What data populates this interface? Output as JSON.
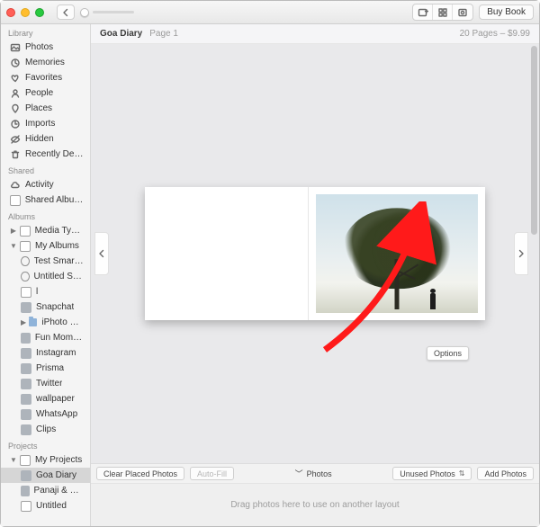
{
  "toolbar": {
    "buy_label": "Buy Book"
  },
  "sidebar": {
    "sections": {
      "library": "Library",
      "shared": "Shared",
      "albums": "Albums",
      "projects": "Projects"
    },
    "library": [
      {
        "label": "Photos"
      },
      {
        "label": "Memories"
      },
      {
        "label": "Favorites"
      },
      {
        "label": "People"
      },
      {
        "label": "Places"
      },
      {
        "label": "Imports"
      },
      {
        "label": "Hidden"
      },
      {
        "label": "Recently Deleted"
      }
    ],
    "shared": [
      {
        "label": "Activity"
      },
      {
        "label": "Shared Albums"
      }
    ],
    "albums": [
      {
        "label": "Media Types",
        "expandable": true
      },
      {
        "label": "My Albums",
        "expandable": true,
        "expanded": true
      }
    ],
    "my_albums": [
      {
        "label": "Test Smart A…"
      },
      {
        "label": "Untitled Sma…"
      },
      {
        "label": "l"
      },
      {
        "label": "Snapchat"
      },
      {
        "label": "iPhoto Events",
        "expandable": true
      },
      {
        "label": "Fun Moments"
      },
      {
        "label": "Instagram"
      },
      {
        "label": "Prisma"
      },
      {
        "label": "Twitter"
      },
      {
        "label": "wallpaper"
      },
      {
        "label": "WhatsApp"
      },
      {
        "label": "Clips"
      }
    ],
    "projects": [
      {
        "label": "My Projects",
        "expandable": true,
        "expanded": true
      }
    ],
    "my_projects": [
      {
        "label": "Goa Diary",
        "selected": true
      },
      {
        "label": "Panaji & Bard…"
      },
      {
        "label": "Untitled"
      }
    ]
  },
  "header": {
    "title": "Goa Diary",
    "page": "Page 1",
    "status": "20 Pages – $9.99"
  },
  "canvas": {
    "options_label": "Options"
  },
  "bottombar": {
    "clear": "Clear Placed Photos",
    "autofill": "Auto-Fill",
    "tab": "Photos",
    "filter": "Unused Photos",
    "add": "Add Photos"
  },
  "drop_hint": "Drag photos here to use on another layout"
}
